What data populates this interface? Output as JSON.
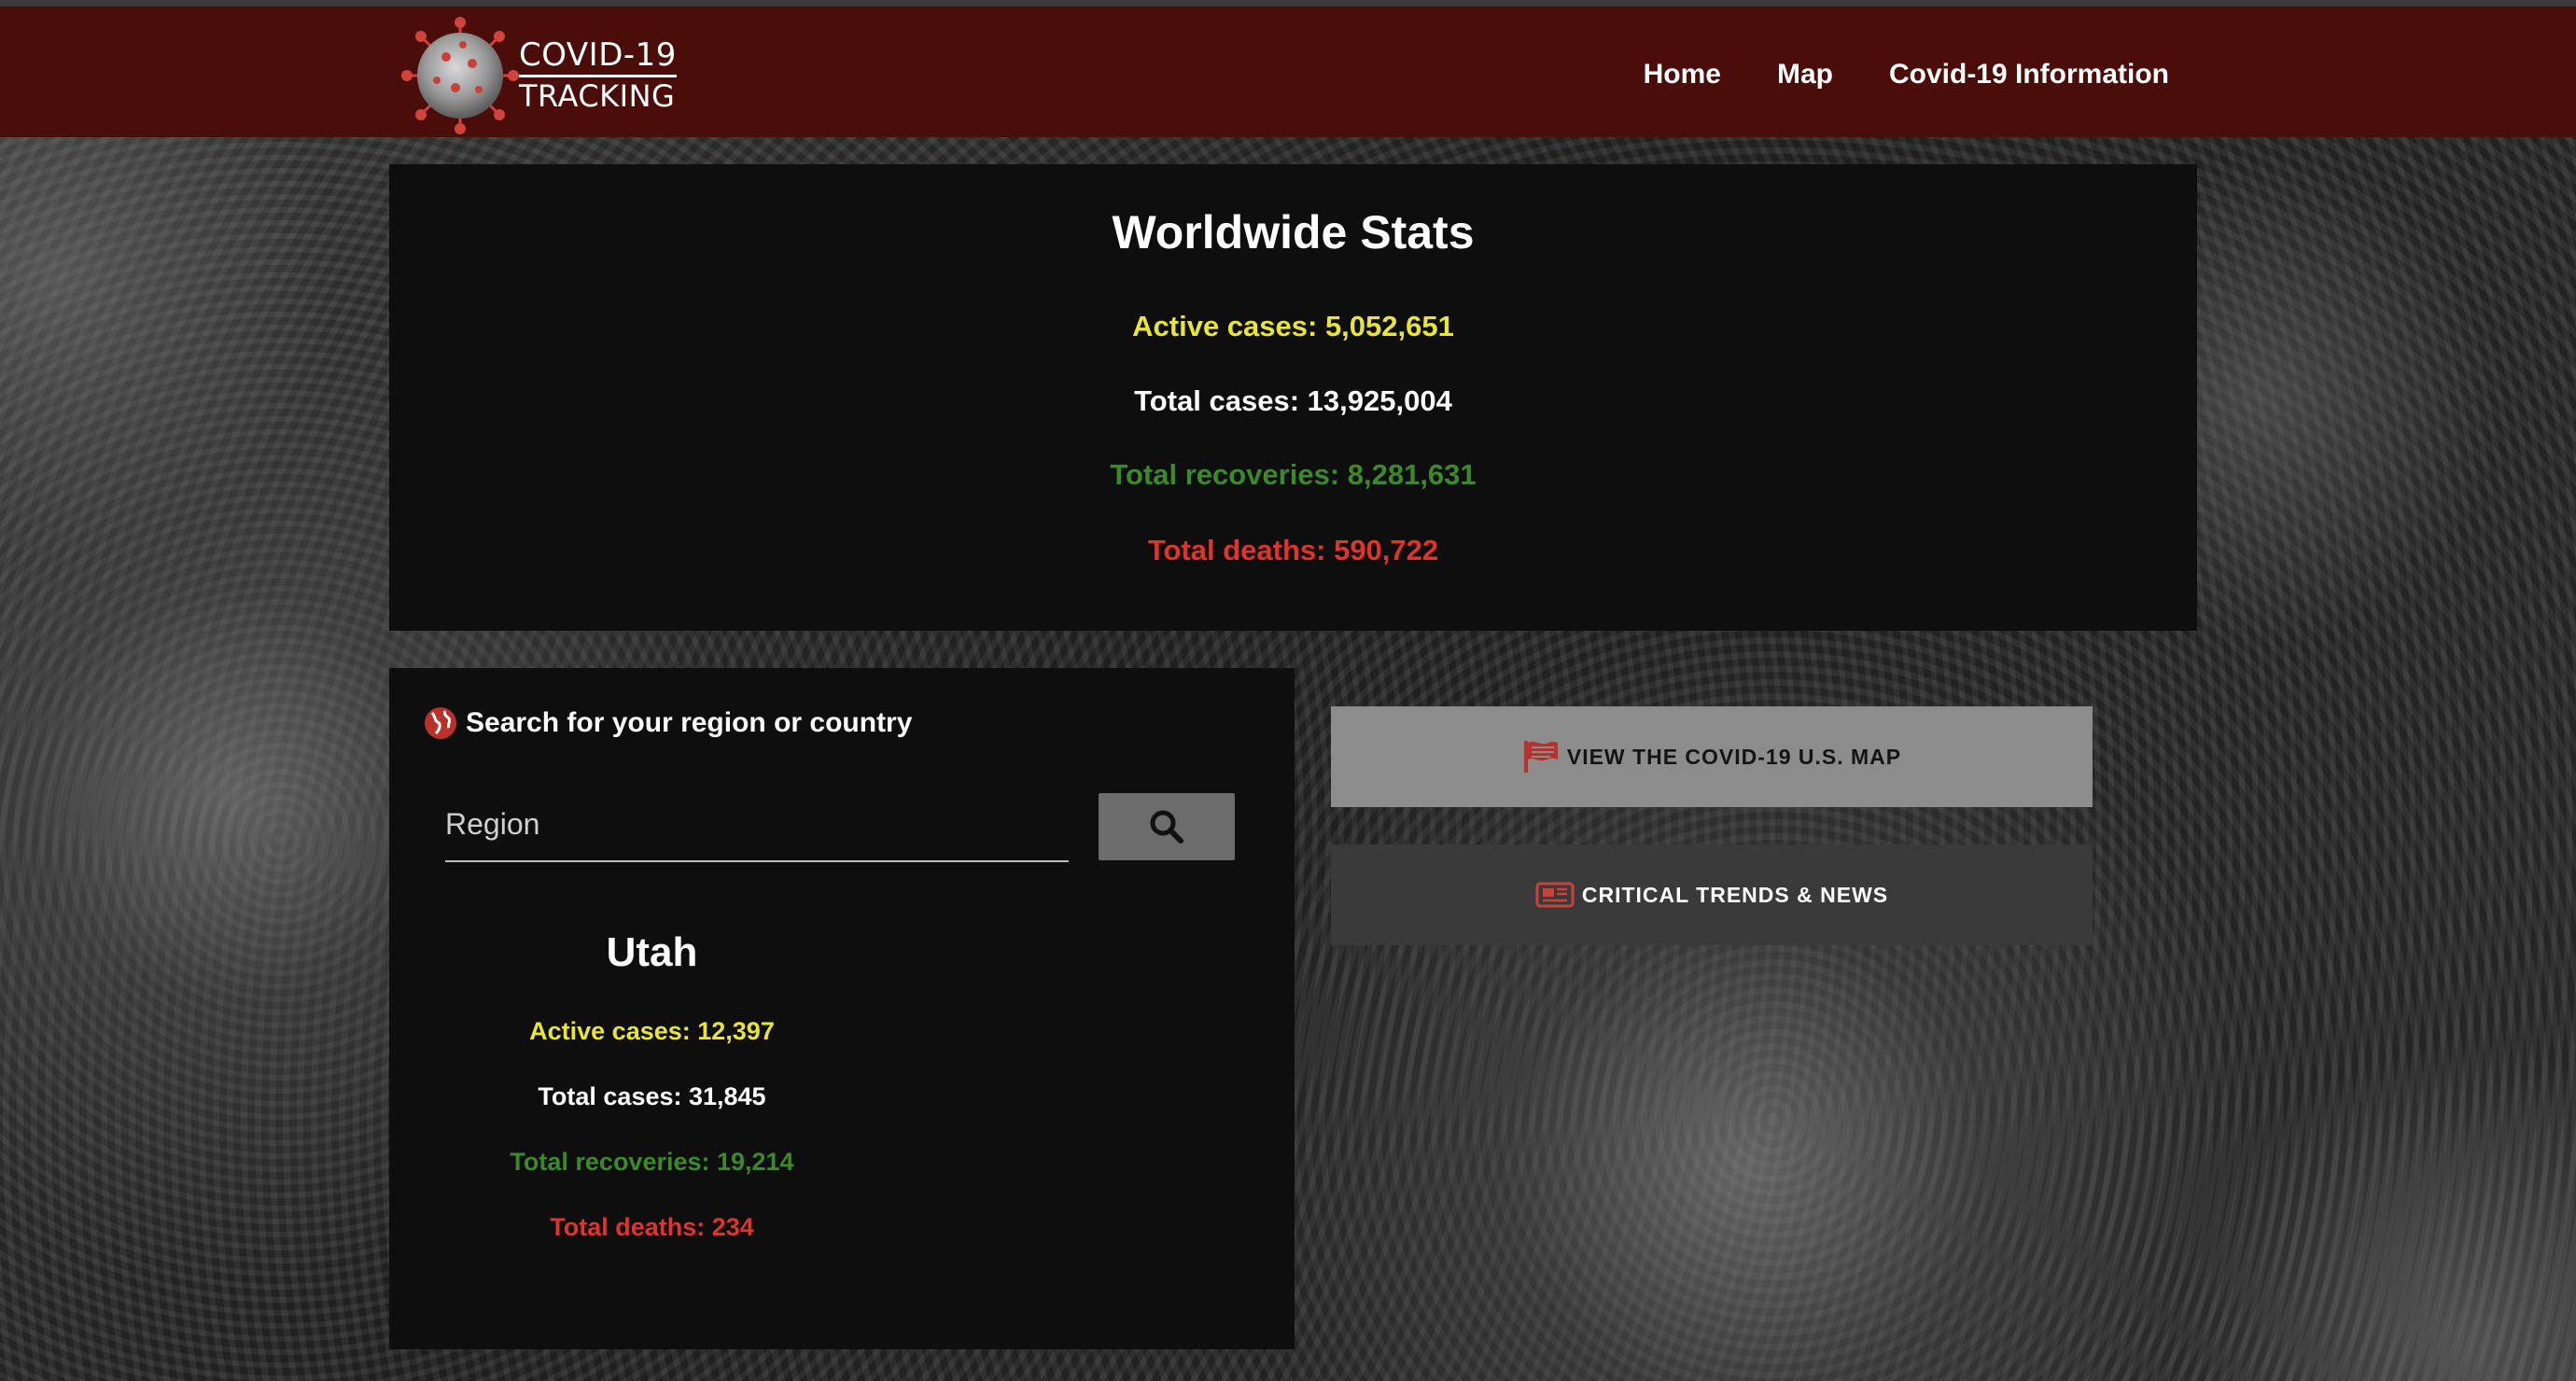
{
  "header": {
    "logo_line1": "COVID-19",
    "logo_line2": "TRACKING",
    "nav": [
      {
        "label": "Home"
      },
      {
        "label": "Map"
      },
      {
        "label": "Covid-19 Information"
      }
    ]
  },
  "worldwide": {
    "title": "Worldwide Stats",
    "active": "Active cases: 5,052,651",
    "total": "Total cases: 13,925,004",
    "recoveries": "Total recoveries: 8,281,631",
    "deaths": "Total deaths: 590,722"
  },
  "search": {
    "title": "Search for your region or country",
    "placeholder": "Region",
    "button_icon": "search-icon"
  },
  "region": {
    "name": "Utah",
    "active": "Active cases: 12,397",
    "total": "Total cases: 31,845",
    "recoveries": "Total recoveries: 19,214",
    "deaths": "Total deaths: 234"
  },
  "actions": {
    "map_label": "VIEW THE COVID-19 U.S. MAP",
    "map_icon": "flag-icon",
    "news_label": "CRITICAL TRENDS & NEWS",
    "news_icon": "newspaper-icon"
  },
  "colors": {
    "header_bg": "#4b0d0a",
    "active": "#e9e533",
    "total": "#ffffff",
    "recoveries": "#3b8a2a",
    "deaths": "#e1332b",
    "icon_red": "#b8312b"
  }
}
